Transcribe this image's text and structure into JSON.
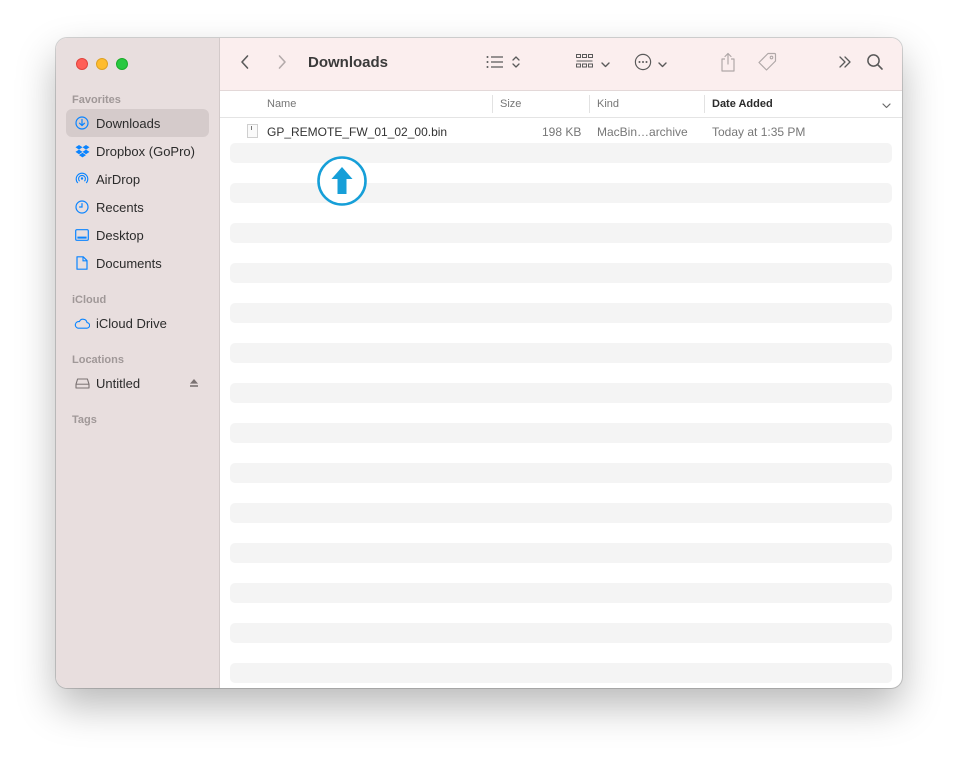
{
  "window": {
    "title": "Downloads"
  },
  "sidebar": {
    "sections": {
      "favorites": "Favorites",
      "icloud": "iCloud",
      "locations": "Locations",
      "tags": "Tags"
    },
    "items": {
      "downloads": "Downloads",
      "dropbox": "Dropbox (GoPro)",
      "airdrop": "AirDrop",
      "recents": "Recents",
      "desktop": "Desktop",
      "documents": "Documents",
      "icloud_drive": "iCloud Drive",
      "untitled": "Untitled"
    },
    "selected": "Downloads"
  },
  "columns": {
    "name": "Name",
    "size": "Size",
    "kind": "Kind",
    "date_added": "Date Added"
  },
  "files": [
    {
      "name": "GP_REMOTE_FW_01_02_00.bin",
      "size": "198 KB",
      "kind": "MacBin…archive",
      "date_added": "Today at 1:35 PM"
    }
  ],
  "icons": {
    "back": "chevron-left-icon",
    "forward": "chevron-right-icon",
    "list_view": "list-view-icon",
    "group": "grid-group-icon",
    "action": "ellipsis-circle-icon",
    "share": "share-icon",
    "tag": "tag-icon",
    "more": "double-chevron-right-icon",
    "search": "search-icon",
    "overlay": "upload-arrow-circle-icon"
  },
  "colors": {
    "accent": "#0a84ff",
    "overlay": "#169fd8",
    "sidebar_bg": "#e8dede",
    "toolbar_bg": "#fbeeee"
  }
}
